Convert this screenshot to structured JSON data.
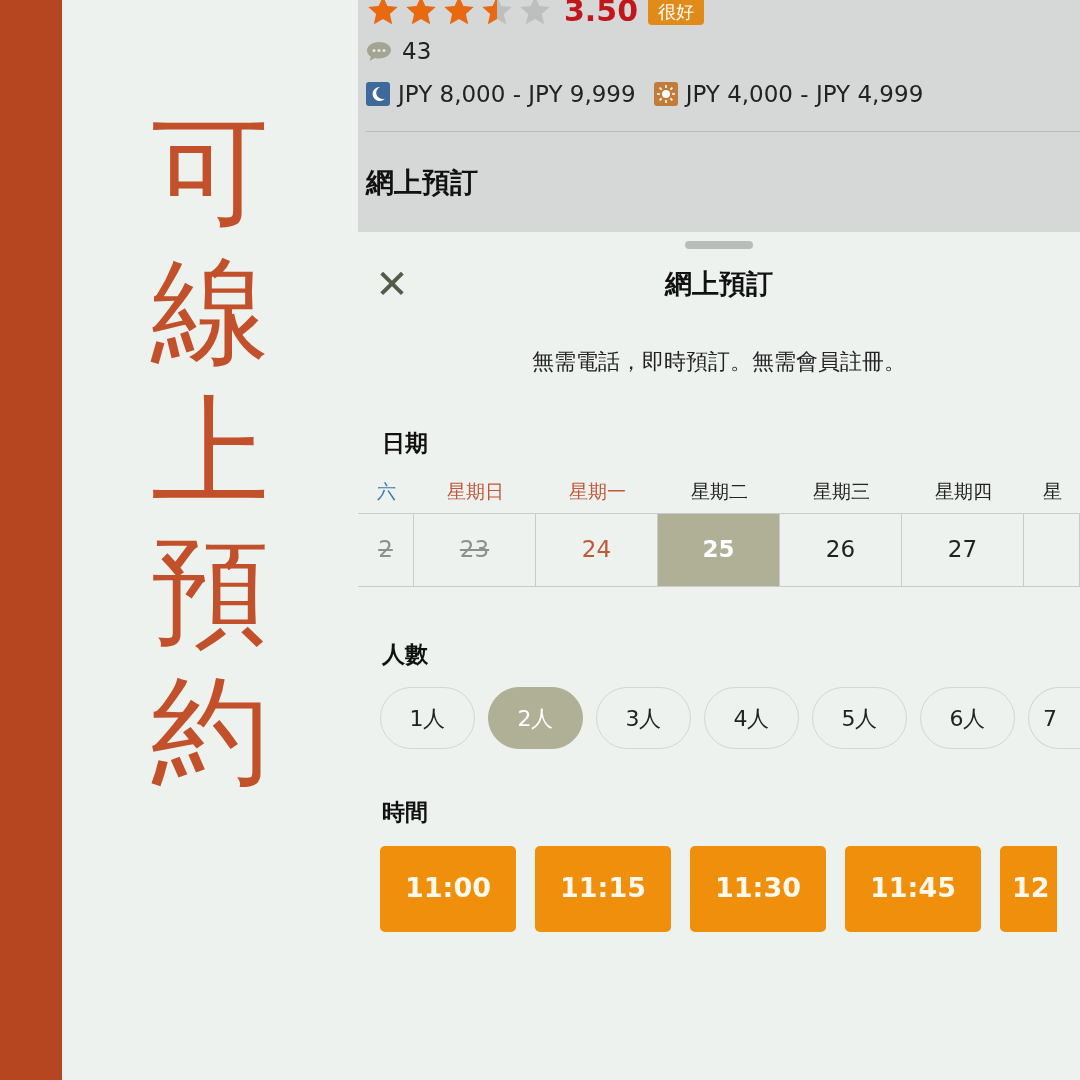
{
  "headline": [
    "可",
    "線",
    "上",
    "預",
    "約"
  ],
  "listing": {
    "stars": 3.5,
    "rating": "3.50",
    "rating_badge": "很好",
    "reviews": "43",
    "prices": [
      {
        "kind": "dinner",
        "text": "JPY 8,000 - JPY 9,999"
      },
      {
        "kind": "lunch",
        "text": "JPY 4,000 - JPY 4,999"
      }
    ],
    "section_title": "網上預訂"
  },
  "sheet": {
    "close": "✕",
    "title": "網上預訂",
    "subtitle": "無需電話，即時預訂。無需會員註冊。",
    "date_label": "日期",
    "days": [
      {
        "weekday": "六",
        "date": "2",
        "kind": "saturday",
        "disabled": true,
        "selected": false
      },
      {
        "weekday": "星期日",
        "date": "23",
        "kind": "holiday",
        "disabled": true,
        "selected": false
      },
      {
        "weekday": "星期一",
        "date": "24",
        "kind": "holiday",
        "disabled": false,
        "selected": false
      },
      {
        "weekday": "星期二",
        "date": "25",
        "kind": "normal",
        "disabled": false,
        "selected": true
      },
      {
        "weekday": "星期三",
        "date": "26",
        "kind": "normal",
        "disabled": false,
        "selected": false
      },
      {
        "weekday": "星期四",
        "date": "27",
        "kind": "normal",
        "disabled": false,
        "selected": false
      },
      {
        "weekday": "星",
        "kind": "normal"
      }
    ],
    "people_label": "人數",
    "people": [
      {
        "label": "1人",
        "selected": false
      },
      {
        "label": "2人",
        "selected": true
      },
      {
        "label": "3人",
        "selected": false
      },
      {
        "label": "4人",
        "selected": false
      },
      {
        "label": "5人",
        "selected": false
      },
      {
        "label": "6人",
        "selected": false
      },
      {
        "label": "7",
        "selected": false
      }
    ],
    "time_label": "時間",
    "times": [
      "11:00",
      "11:15",
      "11:30",
      "11:45",
      "12"
    ]
  }
}
